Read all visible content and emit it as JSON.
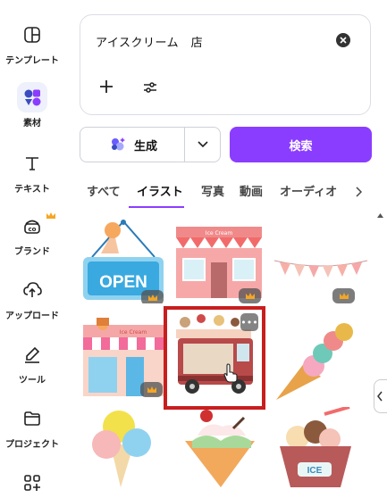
{
  "sidebar": {
    "items": [
      {
        "label": "テンプレート",
        "icon": "template-icon"
      },
      {
        "label": "素材",
        "icon": "elements-icon"
      },
      {
        "label": "テキスト",
        "icon": "text-icon"
      },
      {
        "label": "ブランド",
        "icon": "brand-icon"
      },
      {
        "label": "アップロード",
        "icon": "upload-icon"
      },
      {
        "label": "ツール",
        "icon": "tools-icon"
      },
      {
        "label": "プロジェクト",
        "icon": "folder-icon"
      }
    ]
  },
  "search": {
    "query": "アイスクリーム　店"
  },
  "generate": {
    "label": "生成"
  },
  "search_button": {
    "label": "検索"
  },
  "tabs": [
    "すべて",
    "イラスト",
    "写真",
    "動画",
    "オーディオ"
  ],
  "colors": {
    "accent": "#8b3dff",
    "highlight": "#c81e1e"
  },
  "grid": {
    "row1": [
      {
        "text": "OPEN",
        "premium": true
      },
      {
        "text": "Ice Cream",
        "premium": true
      },
      {
        "premium": true
      }
    ],
    "row2": [
      {
        "text": "Ice Cream",
        "premium": true
      },
      {
        "selected": true
      },
      {
        "premium": false
      }
    ],
    "row3": [
      {
        "premium": false
      },
      {
        "premium": false
      },
      {
        "text": "ICE",
        "premium": false
      }
    ]
  }
}
